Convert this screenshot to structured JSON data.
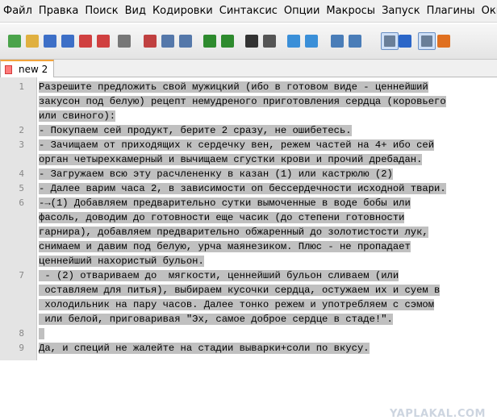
{
  "menu": [
    "Файл",
    "Правка",
    "Поиск",
    "Вид",
    "Кодировки",
    "Синтаксис",
    "Опции",
    "Макросы",
    "Запуск",
    "Плагины",
    "Окна",
    "?"
  ],
  "toolbar_icons": [
    "new-file-icon",
    "open-file-icon",
    "save-icon",
    "save-all-icon",
    "close-icon",
    "close-all-icon",
    "print-icon",
    "cut-icon",
    "copy-icon",
    "paste-icon",
    "undo-icon",
    "redo-icon",
    "find-icon",
    "replace-icon",
    "zoom-in-icon",
    "zoom-out-icon",
    "sync-vertical-icon",
    "sync-horizontal-icon",
    "word-wrap-icon",
    "show-all-chars-icon",
    "indent-guide-icon",
    "user-lang-icon"
  ],
  "tab": {
    "label": "new 2"
  },
  "gutter": {
    "numbers": [
      "1",
      "2",
      "3",
      "4",
      "5",
      "6",
      "7",
      "8",
      "9"
    ]
  },
  "lines": [
    "Разрешите предложить свой мужицкий (ибо в готовом виде - ценнейший",
    "закусон под белую) рецепт немудреного приготовления сердца (коровьего",
    "или свиного):",
    "- Покупаем сей продукт, берите 2 сразу, не ошибетесь.",
    "- Зачищаем от приходящих к сердечку вен, режем частей на 4+ ибо сей",
    "орган четырехкамерный и вычищаем сгустки крови и прочий дребадан.",
    "- Загружаем всю эту расчлененку в казан (1) или кастрюлю (2)",
    "- Далее варим часа 2, в зависимости оп бессердечности исходной твари.",
    "-→(1) Добавляем предварительно сутки вымоченные в воде бобы или",
    "фасоль, доводим до готовности еще часик (до степени готовности",
    "гарнира), добавляем предварительно обжаренный до золотистости лук,",
    "снимаем и давим под белую, урча маянезиком. Плюс - не пропадает",
    "ценнейший нахористый бульон.",
    " - (2) отвариваем до  мягкости, ценнейший бульон сливаем (или",
    " оставляем для питья), выбираем кусочки сердца, остужаем их и суем в",
    " холодильник на пару часов. Далее тонко режем и употребляем с сэмом",
    " или белой, приговаривая \"Эх, самое доброе сердце в стаде!\".",
    "",
    "Да, и специй не жалейте на стадии выварки+соли по вкусу."
  ],
  "watermark": "YAPLAKAL.COM",
  "colors": {
    "selection": "#c0c0c0",
    "gutter": "#e4e4e4",
    "tab_accent": "#f3a43b"
  }
}
